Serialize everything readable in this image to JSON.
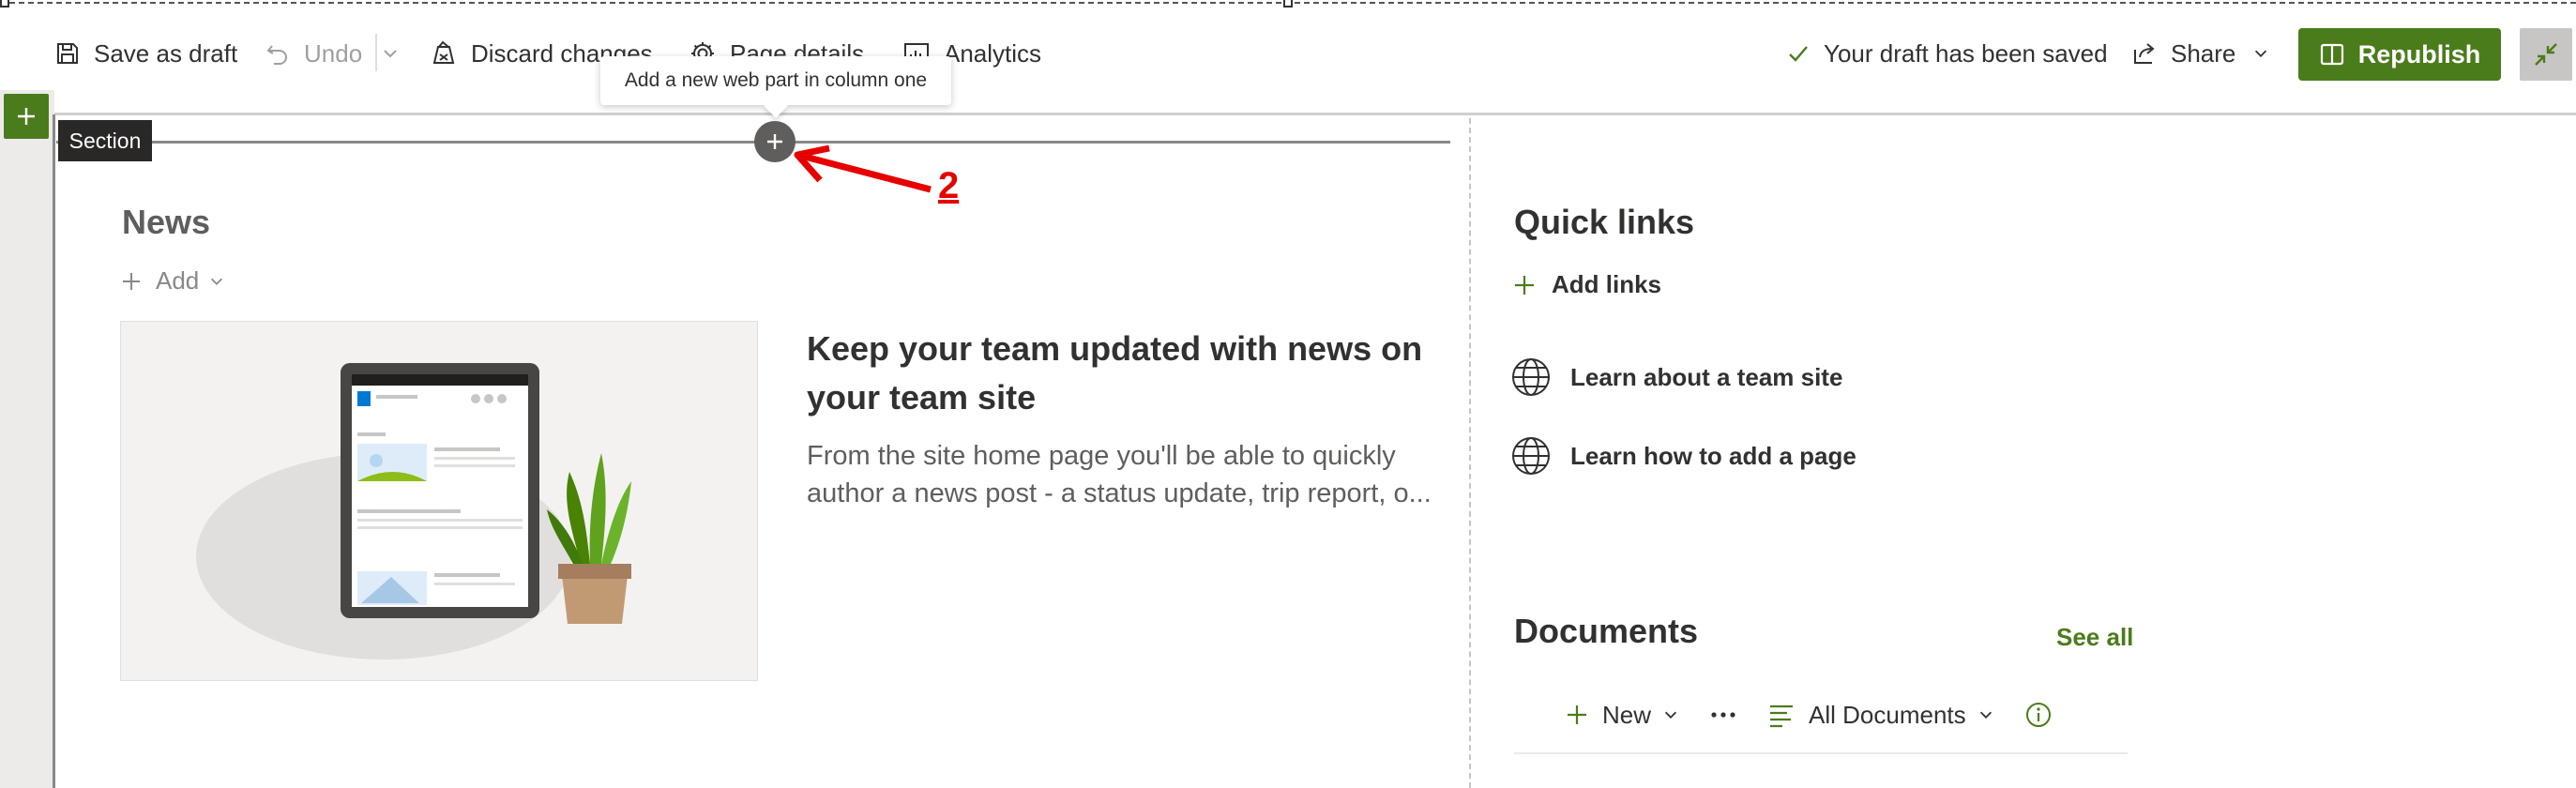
{
  "toolbar": {
    "save_draft": "Save as draft",
    "undo": "Undo",
    "discard": "Discard changes",
    "page_details": "Page details",
    "analytics": "Analytics",
    "status": "Your draft has been saved",
    "share": "Share",
    "republish": "Republish",
    "icons": {
      "save": "save-icon",
      "undo": "undo-icon",
      "discard": "discard-icon",
      "details": "gear-icon",
      "analytics": "analytics-icon",
      "check": "check-icon",
      "share": "share-icon",
      "republish": "book-icon",
      "collapse": "collapse-icon"
    }
  },
  "canvas": {
    "section_label": "Section",
    "add_webpart_tooltip": "Add a new web part in column one",
    "annotation_number": "2"
  },
  "news": {
    "title": "News",
    "add_label": "Add",
    "heading": "Keep your team updated with news on your team site",
    "description": "From the site home page you'll be able to quickly author a news post - a status update, trip report, o..."
  },
  "quick_links": {
    "title": "Quick links",
    "add_label": "Add links",
    "items": [
      {
        "label": "Learn about a team site",
        "icon": "globe-icon"
      },
      {
        "label": "Learn how to add a page",
        "icon": "globe-icon"
      }
    ]
  },
  "documents": {
    "title": "Documents",
    "see_all": "See all",
    "new_label": "New",
    "view_label": "All Documents"
  },
  "colors": {
    "accent": "#4b7c1c",
    "annotation": "#e60000",
    "section_tag_bg": "#292827"
  }
}
